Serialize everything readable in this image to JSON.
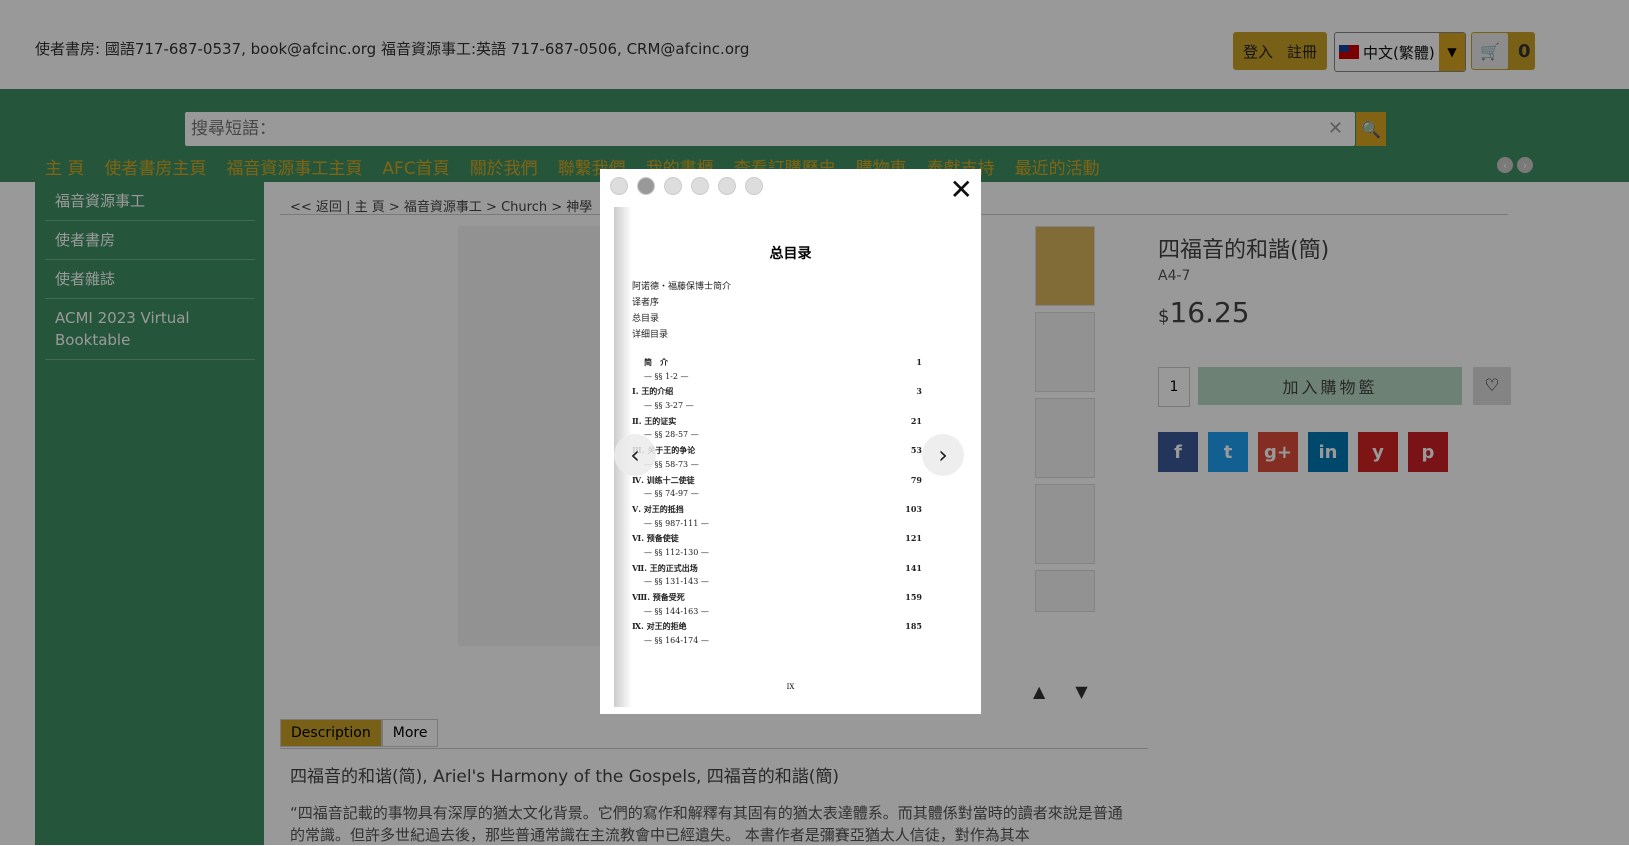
{
  "header": {
    "contact": "使者書房: 國語717-687-0537, book@afcinc.org 福音資源事工:英語 717-687-0506, CRM@afcinc.org",
    "login": "登入",
    "register": "註冊",
    "language": "中文(繁體)",
    "cart_count": "0"
  },
  "search": {
    "placeholder": "搜尋短語："
  },
  "nav": {
    "items": [
      "主 頁",
      "使者書房主頁",
      "福音資源事工主頁",
      "AFC首頁",
      "關於我們",
      "聯繫我們",
      "我的書櫃",
      "查看訂購歷史",
      "購物車",
      "奉獻支持",
      "最近的活動"
    ]
  },
  "sidebar": {
    "items": [
      "福音資源事工",
      "使者書房",
      "使者雜誌",
      "ACMI 2023 Virtual Booktable"
    ]
  },
  "breadcrumb": {
    "back": "<< 返回",
    "sep": "|",
    "items": [
      "主 頁",
      "福音資源事工",
      "Church",
      "神學"
    ]
  },
  "product": {
    "title": "四福音的和諧(簡)",
    "sku": "A4-7",
    "currency": "$",
    "price": "16.25",
    "qty": "1",
    "add_to_cart": "加入購物籃"
  },
  "tabs": [
    "Description",
    "More"
  ],
  "description": {
    "title": "四福音的和谐(简), Ariel's Harmony of the Gospels, 四福音的和諧(簡)",
    "body": "“四福音記載的事物具有深厚的猶太文化背景。它們的寫作和解釋有其固有的猶太表達體系。而其體係對當時的讀者來說是普通的常識。但許多世紀過去後，那些普通常識在主流教會中已經遺失。 本書作者是彌賽亞猶太人信徒，對作為其本"
  },
  "modal": {
    "heading": "总目录",
    "front_matter": [
      "阿诺德・福藤保博士简介",
      "译者序",
      "总目录",
      "详细目录"
    ],
    "toc": [
      {
        "label": "简　介",
        "page": "1",
        "type": "chap"
      },
      {
        "label": "— §§ 1-2 —",
        "page": "",
        "type": "sec"
      },
      {
        "label": "Ⅰ. 王的介绍",
        "page": "3",
        "type": "chap"
      },
      {
        "label": "— §§ 3-27 —",
        "page": "",
        "type": "sec"
      },
      {
        "label": "Ⅱ. 王的证实",
        "page": "21",
        "type": "chap"
      },
      {
        "label": "— §§ 28-57 —",
        "page": "",
        "type": "sec"
      },
      {
        "label": "Ⅲ. 关于王的争论",
        "page": "53",
        "type": "chap"
      },
      {
        "label": "— §§ 58-73 —",
        "page": "",
        "type": "sec"
      },
      {
        "label": "Ⅳ. 训练十二使徒",
        "page": "79",
        "type": "chap"
      },
      {
        "label": "— §§ 74-97 —",
        "page": "",
        "type": "sec"
      },
      {
        "label": "Ⅴ. 对王的抵挡",
        "page": "103",
        "type": "chap"
      },
      {
        "label": "— §§ 987-111 —",
        "page": "",
        "type": "sec"
      },
      {
        "label": "Ⅵ. 预备使徒",
        "page": "121",
        "type": "chap"
      },
      {
        "label": "— §§ 112-130 —",
        "page": "",
        "type": "sec"
      },
      {
        "label": "Ⅶ. 王的正式出场",
        "page": "141",
        "type": "chap"
      },
      {
        "label": "— §§ 131-143 —",
        "page": "",
        "type": "sec"
      },
      {
        "label": "Ⅷ. 预备受死",
        "page": "159",
        "type": "chap"
      },
      {
        "label": "— §§ 144-163 —",
        "page": "",
        "type": "sec"
      },
      {
        "label": "Ⅸ. 对王的拒绝",
        "page": "185",
        "type": "chap"
      },
      {
        "label": "— §§ 164-174 —",
        "page": "",
        "type": "sec"
      }
    ],
    "page_number": "IX"
  }
}
